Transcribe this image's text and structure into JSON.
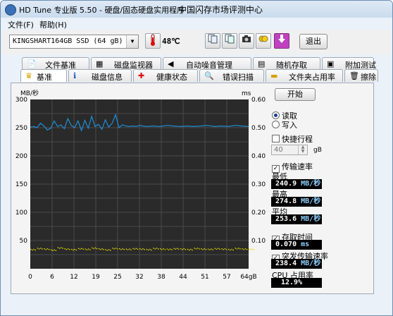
{
  "window": {
    "title": "HD Tune 专业版 5.50 - 硬盘/固态硬盘实用程序",
    "title_extra": "中国闪存市场评测中心"
  },
  "menu": {
    "file": "文件(F)",
    "help": "帮助(H)"
  },
  "toolbar": {
    "drive": "KINGSHART164GB SSD (64 gB)",
    "temperature": "48℃",
    "exit_label": "退出",
    "icons": [
      "thermometer-icon",
      "copy-icon",
      "copy-alt-icon",
      "camera-icon",
      "save-icon",
      "download-icon"
    ]
  },
  "tabs_row1": [
    {
      "label": "文件基准",
      "icon": "file-benchmark-icon"
    },
    {
      "label": "磁盘监视器",
      "icon": "disk-monitor-icon"
    },
    {
      "label": "自动噪音管理",
      "icon": "speaker-icon"
    },
    {
      "label": "随机存取",
      "icon": "random-access-icon"
    },
    {
      "label": "附加测试",
      "icon": "extra-tests-icon"
    }
  ],
  "tabs_row2": [
    {
      "label": "基准",
      "icon": "benchmark-icon",
      "active": true
    },
    {
      "label": "磁盘信息",
      "icon": "info-icon"
    },
    {
      "label": "健康状态",
      "icon": "health-cross-icon"
    },
    {
      "label": "错误扫描",
      "icon": "error-scan-icon"
    },
    {
      "label": "文件夹占用率",
      "icon": "folder-icon"
    },
    {
      "label": "擦除",
      "icon": "trash-icon"
    }
  ],
  "controls": {
    "start_label": "开始",
    "read_label": "读取",
    "write_label": "写入",
    "mode": "read",
    "quick_label": "快捷行程",
    "quick_checked": false,
    "quick_value": "40",
    "quick_unit": "gB",
    "transfer_label": "传输速率",
    "transfer_checked": true,
    "min_label": "最低",
    "min_value": "240.9",
    "max_label": "最高",
    "max_value": "274.8",
    "avg_label": "平均",
    "avg_value": "253.6",
    "rate_unit": "MB/秒",
    "access_label": "存取时间",
    "access_checked": true,
    "access_value": "0.070",
    "access_unit": "ms",
    "burst_label": "突发传输速率",
    "burst_checked": true,
    "burst_value": "238.4",
    "burst_unit": "MB/秒",
    "cpu_label": "CPU 占用率",
    "cpu_value": "12.9%"
  },
  "chart_data": {
    "type": "line",
    "y_left_label": "MB/秒",
    "y_right_label": "ms",
    "y_left_ticks": [
      "300",
      "250",
      "200",
      "150",
      "100",
      "50"
    ],
    "y_right_ticks": [
      "0.60",
      "0.50",
      "0.40",
      "0.30",
      "0.20",
      "0.10"
    ],
    "x_ticks": [
      "0",
      "6",
      "12",
      "19",
      "25",
      "32",
      "38",
      "44",
      "51",
      "57",
      "64gB"
    ],
    "xlim": [
      0,
      64
    ],
    "ylim_left": [
      0,
      300
    ],
    "ylim_right": [
      0,
      0.6
    ],
    "grid": true,
    "series": [
      {
        "name": "传输速率",
        "axis": "left",
        "color": "#1e8fd8",
        "x": [
          0,
          1,
          2,
          3,
          4,
          5,
          6,
          7,
          8,
          9,
          10,
          11,
          12,
          13,
          14,
          15,
          16,
          17,
          18,
          19,
          20,
          21,
          22,
          23,
          24,
          25,
          26,
          27,
          28,
          29,
          30,
          31,
          32,
          34,
          36,
          38,
          40,
          42,
          44,
          46,
          48,
          50,
          52,
          54,
          56,
          58,
          60,
          62,
          64
        ],
        "y": [
          251,
          252,
          250,
          258,
          253,
          246,
          249,
          262,
          252,
          255,
          248,
          266,
          254,
          250,
          262,
          245,
          263,
          249,
          270,
          252,
          256,
          247,
          264,
          251,
          258,
          273,
          250,
          255,
          253,
          252,
          253,
          252,
          254,
          252,
          253,
          252,
          254,
          253,
          252,
          253,
          252,
          253,
          254,
          252,
          253,
          252,
          254,
          253,
          252
        ]
      },
      {
        "name": "存取时间",
        "axis": "right",
        "color": "#e8e000",
        "style": "scatter",
        "x": [
          0,
          2,
          4,
          6,
          8,
          10,
          12,
          14,
          16,
          18,
          20,
          22,
          24,
          26,
          28,
          30,
          32,
          34,
          36,
          38,
          40,
          42,
          44,
          46,
          48,
          50,
          52,
          54,
          56,
          58,
          60,
          62,
          64
        ],
        "y": [
          0.068,
          0.072,
          0.07,
          0.066,
          0.074,
          0.07,
          0.068,
          0.071,
          0.069,
          0.073,
          0.07,
          0.067,
          0.072,
          0.07,
          0.069,
          0.071,
          0.07,
          0.068,
          0.072,
          0.07,
          0.069,
          0.071,
          0.07,
          0.068,
          0.072,
          0.07,
          0.069,
          0.071,
          0.07,
          0.068,
          0.072,
          0.07,
          0.069
        ]
      }
    ]
  }
}
